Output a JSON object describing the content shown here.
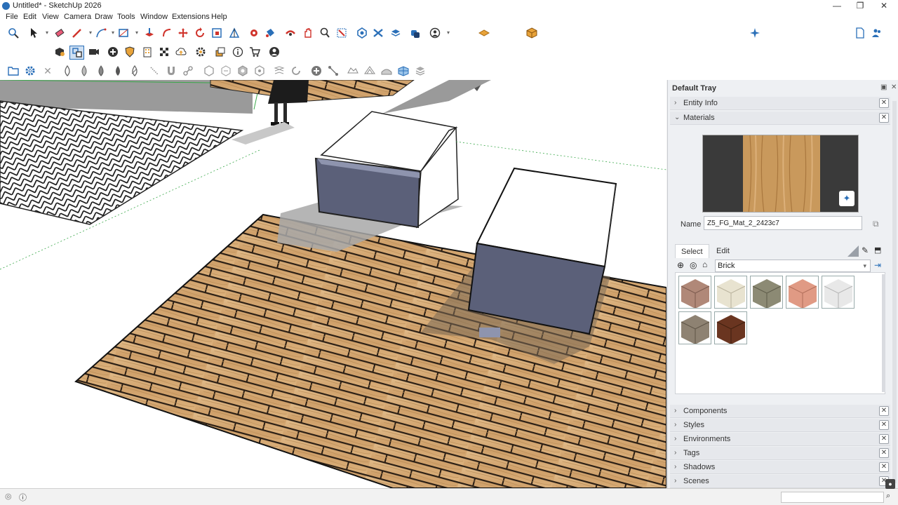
{
  "window": {
    "title": "Untitled* - SketchUp 2026",
    "controls": {
      "minimize": "—",
      "maximize": "❐",
      "close": "✕"
    }
  },
  "menu": [
    "File",
    "Edit",
    "View",
    "Camera",
    "Draw",
    "Tools",
    "Window",
    "Extensions",
    "Help"
  ],
  "tray": {
    "title": "Default Tray",
    "sections_top": [
      {
        "label": "Entity Info",
        "expanded": false
      },
      {
        "label": "Materials",
        "expanded": true
      }
    ],
    "sections_bottom": [
      {
        "label": "Components"
      },
      {
        "label": "Styles"
      },
      {
        "label": "Environments"
      },
      {
        "label": "Tags"
      },
      {
        "label": "Shadows"
      },
      {
        "label": "Scenes"
      }
    ],
    "materials": {
      "name_label": "Name",
      "name_value": "Z5_FG_Mat_2_2423c7",
      "tabs": [
        "Select",
        "Edit"
      ],
      "active_tab": "Select",
      "library": "Brick",
      "swatches": [
        {
          "color": "#b08878",
          "name": "brick-swatch-1"
        },
        {
          "color": "#e8e3d0",
          "name": "brick-swatch-2"
        },
        {
          "color": "#8c8a74",
          "name": "brick-swatch-3"
        },
        {
          "color": "#e09a84",
          "name": "brick-swatch-4"
        },
        {
          "color": "#e8e8e8",
          "name": "brick-swatch-5"
        },
        {
          "color": "#8e8272",
          "name": "brick-swatch-6"
        },
        {
          "color": "#6a3520",
          "name": "brick-swatch-7"
        }
      ]
    }
  },
  "colors": {
    "accent": "#2a6fb8",
    "box_side": "#5b6079",
    "wood_light": "#d9b07e",
    "wood_dark": "#b8864f"
  }
}
